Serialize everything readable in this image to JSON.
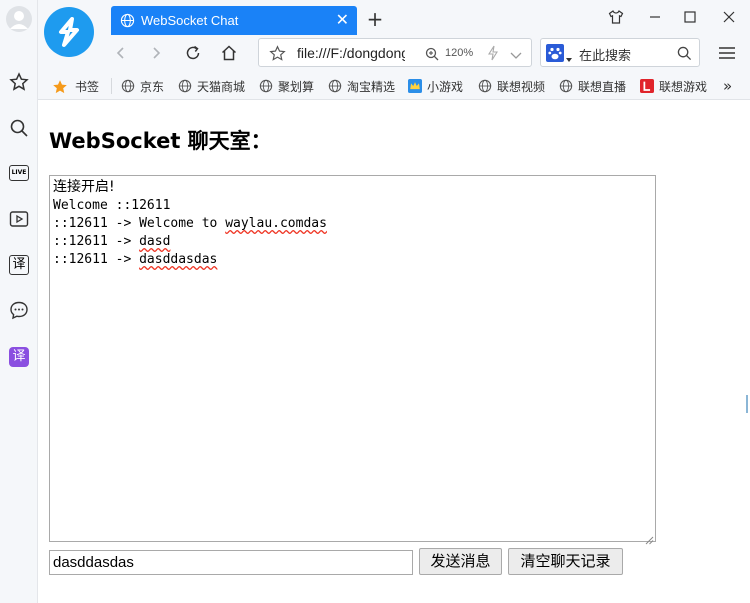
{
  "browser": {
    "tab_title": "WebSocket Chat",
    "tab_close": "✕",
    "new_tab": "+",
    "url": "file:///F:/dongdong",
    "zoom": "120%",
    "search_placeholder": "在此搜索",
    "accent": "#1a82f7"
  },
  "bookmarks": {
    "items": [
      {
        "label": "书签",
        "icon": "star-icon"
      },
      {
        "label": "京东",
        "icon": "globe-icon"
      },
      {
        "label": "天猫商城",
        "icon": "globe-icon"
      },
      {
        "label": "聚划算",
        "icon": "globe-icon"
      },
      {
        "label": "淘宝精选",
        "icon": "globe-icon"
      },
      {
        "label": "小游戏",
        "icon": "crown-icon"
      },
      {
        "label": "联想视频",
        "icon": "globe-icon"
      },
      {
        "label": "联想直播",
        "icon": "globe-icon"
      },
      {
        "label": "联想游戏",
        "icon": "l-icon"
      }
    ],
    "more": "»"
  },
  "sidebar": {
    "live_label": "LIVE",
    "translate_label": "译",
    "translate2_label": "译"
  },
  "page": {
    "heading": "WebSocket 聊天室：",
    "chat_lines": [
      {
        "prefix": "连接开启!",
        "text": ""
      },
      {
        "prefix": "Welcome ::12611",
        "text": ""
      },
      {
        "prefix": "::12611 -> Welcome to ",
        "text": "waylau.comdas"
      },
      {
        "prefix": "::12611 -> ",
        "text": "dasd"
      },
      {
        "prefix": "::12611 -> ",
        "text": "dasddasdas"
      }
    ],
    "input_value": "dasddasdas",
    "send_button": "发送消息",
    "clear_button": "清空聊天记录"
  }
}
